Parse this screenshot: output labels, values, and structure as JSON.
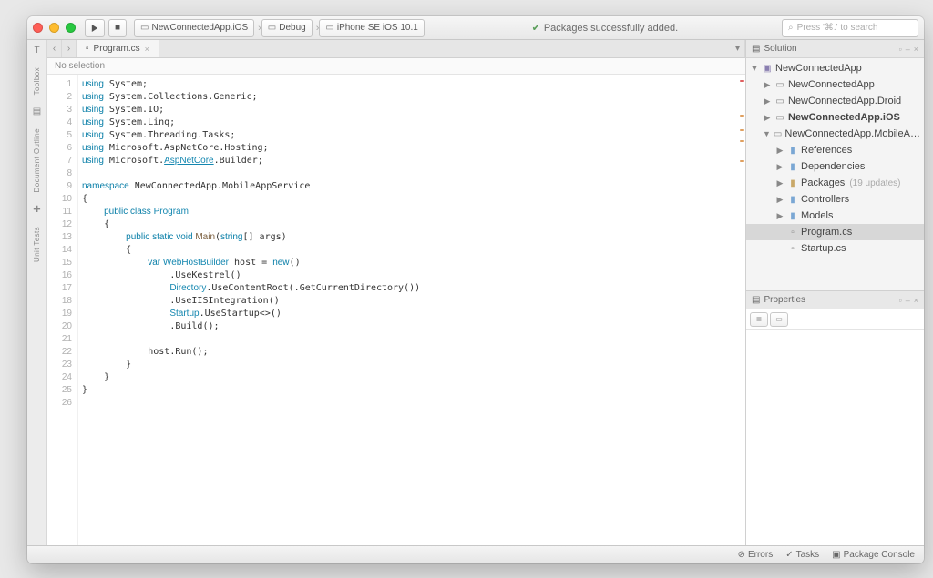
{
  "toolbar": {
    "project": "NewConnectedApp.iOS",
    "config": "Debug",
    "device": "iPhone SE iOS 10.1",
    "status_message": "Packages successfully added.",
    "search_placeholder": "Press '⌘.' to search"
  },
  "tabs": {
    "active": "Program.cs"
  },
  "editor": {
    "selection_status": "No selection",
    "line_count": 26,
    "code_lines": [
      {
        "t": "using",
        "r": " System;"
      },
      {
        "t": "using",
        "r": " System.Collections.Generic;"
      },
      {
        "t": "using",
        "r": " System.IO;"
      },
      {
        "t": "using",
        "r": " System.Linq;"
      },
      {
        "t": "using",
        "r": " System.Threading.Tasks;"
      },
      {
        "t": "using",
        "r": " Microsoft.AspNetCore.Hosting;"
      },
      {
        "t": "using",
        "r": " Microsoft.",
        "u": "AspNetCore",
        "r2": ".Builder;"
      },
      {
        "raw": ""
      },
      {
        "t": "namespace",
        "r": " NewConnectedApp.MobileAppService"
      },
      {
        "raw": "{"
      },
      {
        "indent": 1,
        "t": "public class",
        "cls": " Program"
      },
      {
        "indent": 1,
        "raw": "{"
      },
      {
        "indent": 2,
        "t": "public static void",
        "mth": " Main",
        "sig": "(",
        "kw2": "string",
        "sig2": "[] args)"
      },
      {
        "indent": 2,
        "raw": "{"
      },
      {
        "indent": 3,
        "t": "var",
        "r": " host = ",
        "t2": "new",
        "cls": " WebHostBuilder",
        "r2": "()"
      },
      {
        "indent": 4,
        "r": ".UseKestrel()"
      },
      {
        "indent": 4,
        "r": ".UseContentRoot(",
        "cls": "Directory",
        "r2": ".GetCurrentDirectory())"
      },
      {
        "indent": 4,
        "r": ".UseIISIntegration()"
      },
      {
        "indent": 4,
        "r": ".UseStartup<",
        "cls": "Startup",
        "r2": ">()"
      },
      {
        "indent": 4,
        "r": ".Build();"
      },
      {
        "raw": ""
      },
      {
        "indent": 3,
        "r": "host.Run();"
      },
      {
        "indent": 2,
        "raw": "}"
      },
      {
        "indent": 1,
        "raw": "}"
      },
      {
        "raw": "}"
      },
      {
        "raw": ""
      }
    ]
  },
  "left_sidebar": {
    "pads": [
      "Toolbox",
      "Document Outline",
      "Unit Tests"
    ]
  },
  "solution": {
    "title": "Solution",
    "nodes": [
      {
        "depth": 0,
        "expand": "▼",
        "icon": "sol",
        "label": "NewConnectedApp"
      },
      {
        "depth": 1,
        "expand": "▶",
        "icon": "proj",
        "label": "NewConnectedApp"
      },
      {
        "depth": 1,
        "expand": "▶",
        "icon": "proj",
        "label": "NewConnectedApp.Droid"
      },
      {
        "depth": 1,
        "expand": "▶",
        "icon": "proj",
        "label": "NewConnectedApp.iOS",
        "bold": true
      },
      {
        "depth": 1,
        "expand": "▼",
        "icon": "proj",
        "label": "NewConnectedApp.MobileAppService"
      },
      {
        "depth": 2,
        "expand": "▶",
        "icon": "folder",
        "label": "References"
      },
      {
        "depth": 2,
        "expand": "▶",
        "icon": "folder",
        "label": "Dependencies"
      },
      {
        "depth": 2,
        "expand": "▶",
        "icon": "folder-y",
        "label": "Packages",
        "suffix": "(19 updates)"
      },
      {
        "depth": 2,
        "expand": "▶",
        "icon": "folder",
        "label": "Controllers"
      },
      {
        "depth": 2,
        "expand": "▶",
        "icon": "folder",
        "label": "Models"
      },
      {
        "depth": 2,
        "expand": "",
        "icon": "cs",
        "label": "Program.cs",
        "selected": true
      },
      {
        "depth": 2,
        "expand": "",
        "icon": "cs",
        "label": "Startup.cs"
      }
    ]
  },
  "properties": {
    "title": "Properties"
  },
  "statusbar": {
    "errors": "Errors",
    "tasks": "Tasks",
    "console": "Package Console"
  }
}
